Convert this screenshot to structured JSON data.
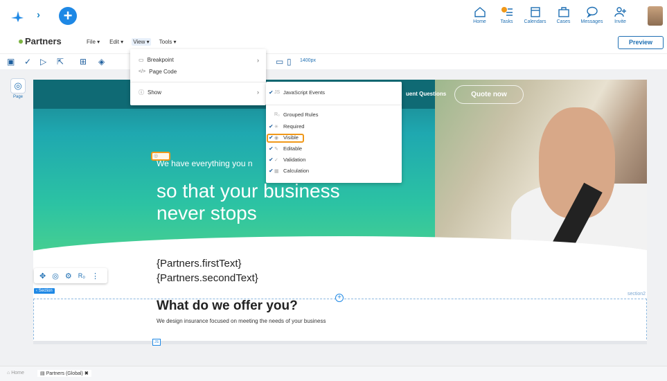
{
  "topbar": {
    "nav": [
      {
        "label": "Home",
        "icon": "home-icon"
      },
      {
        "label": "Tasks",
        "icon": "tasks-icon",
        "badge_color": "#f09819"
      },
      {
        "label": "Calendars",
        "icon": "calendar-icon"
      },
      {
        "label": "Cases",
        "icon": "briefcase-icon"
      },
      {
        "label": "Messages",
        "icon": "chat-icon"
      },
      {
        "label": "Invite",
        "icon": "invite-icon"
      }
    ]
  },
  "app": {
    "title": "Partners",
    "status_color": "#7cb342"
  },
  "menubar": {
    "file": "File",
    "edit": "Edit",
    "view": "View",
    "tools": "Tools"
  },
  "preview_label": "Preview",
  "toolbar": {
    "zoom_label": "1400px"
  },
  "side": {
    "page_label": "Page"
  },
  "view_menu": {
    "breakpoint": "Breakpoint",
    "page_code": "Page Code",
    "show": "Show"
  },
  "show_menu": {
    "items": [
      {
        "label": "JavaScript Events",
        "checked": true,
        "icon": "js-icon"
      },
      {
        "label": "Grouped Rules",
        "checked": false,
        "icon": "rules-icon"
      },
      {
        "label": "Required",
        "checked": true,
        "icon": "asterisk-icon"
      },
      {
        "label": "Visible",
        "checked": true,
        "icon": "eye-icon"
      },
      {
        "label": "Editable",
        "checked": true,
        "icon": "pencil-icon"
      },
      {
        "label": "Validation",
        "checked": true,
        "icon": "check-icon"
      },
      {
        "label": "Calculation",
        "checked": true,
        "icon": "calculator-icon"
      }
    ]
  },
  "hero": {
    "faq_text": "uent Questions",
    "quote_button": "Quote now",
    "small_text": "We have everything you n",
    "big_text": "so that your business never stops"
  },
  "fields": {
    "first": "{Partners.firstText}",
    "second": "{Partners.secondText}"
  },
  "section": {
    "tag": "‹ Section",
    "name": "section2",
    "title": "What do we offer you?",
    "subtitle": "We design insurance focused on meeting the needs of your business"
  },
  "statusbar": {
    "home": "Home",
    "tab": "Partners (Global)"
  },
  "colors": {
    "accent": "#1e88e5",
    "highlight": "#f09819",
    "hero_teal": "#1fa8b0",
    "hero_green": "#49d08f"
  }
}
